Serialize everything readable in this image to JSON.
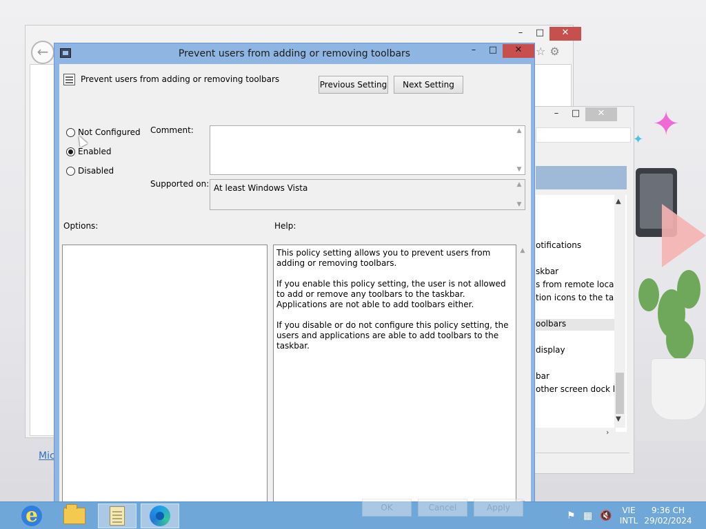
{
  "background_window": {
    "link_text": "Mic"
  },
  "gp_editor": {
    "items": [
      "otifications",
      "skbar",
      "s from remote loca...",
      "tion icons to the ta...",
      "oolbars",
      "display",
      "bar",
      "other screen dock l..."
    ]
  },
  "dialog": {
    "title": "Prevent users from adding or removing toolbars",
    "setting_name": "Prevent users from adding or removing toolbars",
    "prev_button": "Previous Setting",
    "next_button": "Next Setting",
    "radios": {
      "not_configured": "Not Configured",
      "enabled": "Enabled",
      "disabled": "Disabled",
      "selected": "enabled"
    },
    "comment_label": "Comment:",
    "comment_value": "",
    "supported_label": "Supported on:",
    "supported_value": "At least Windows Vista",
    "options_label": "Options:",
    "help_label": "Help:",
    "help_paragraphs": [
      "This policy setting allows you to prevent users from adding or removing toolbars.",
      "If you enable this policy setting, the user is not allowed to add or remove any toolbars to the taskbar. Applications are not able to add toolbars either.",
      "If you disable or do not configure this policy setting, the users and applications are able to add toolbars to the taskbar."
    ],
    "ok_button": "OK",
    "cancel_button": "Cancel",
    "apply_button": "Apply"
  },
  "taskbar": {
    "apps": [
      "internet-explorer",
      "file-explorer",
      "notepad",
      "edge"
    ],
    "language_top": "VIE",
    "language_bottom": "INTL",
    "time": "9:36 CH",
    "date": "29/02/2024"
  }
}
